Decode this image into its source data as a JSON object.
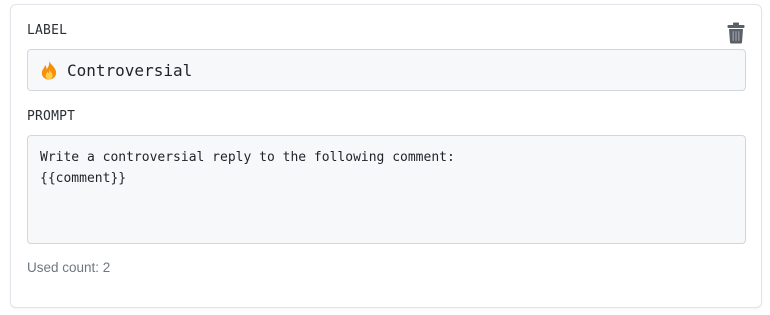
{
  "label_section": {
    "heading": "LABEL",
    "value": "Controversial",
    "emoji_icon": "fire-icon"
  },
  "prompt_section": {
    "heading": "PROMPT",
    "value": "Write a controversial reply to the following comment:\n{{comment}}"
  },
  "footer": {
    "used_count_text": "Used count: 2"
  },
  "actions": {
    "delete_icon": "trash-icon"
  },
  "colors": {
    "field_bg": "#f6f8fa",
    "field_border": "#d0d7de",
    "muted_text": "#6e7781",
    "icon": "#5a6068"
  }
}
